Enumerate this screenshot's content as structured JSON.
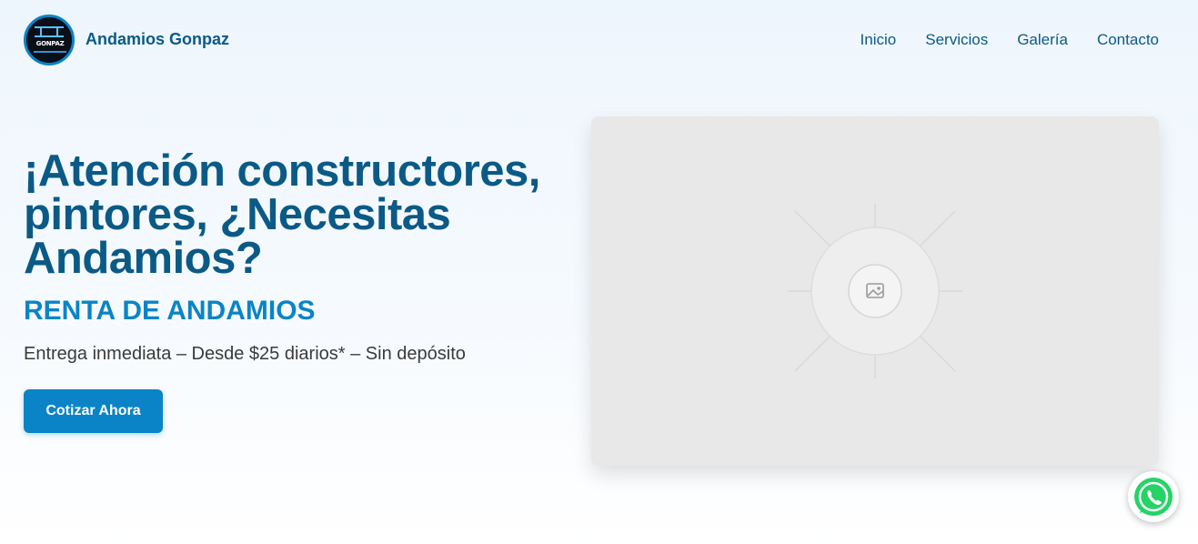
{
  "brand": {
    "name": "Andamios Gonpaz",
    "logo_text": "GONPAZ"
  },
  "nav": {
    "items": [
      "Inicio",
      "Servicios",
      "Galería",
      "Contacto"
    ]
  },
  "hero": {
    "headline": "¡Atención constructores, pintores, ¿Necesitas Andamios?",
    "subheadline": "RENTA DE ANDAMIOS",
    "tagline": "Entrega inmediata – Desde $25 diarios* – Sin depósito",
    "cta_label": "Cotizar Ahora",
    "media_icon": "image-placeholder-icon"
  },
  "floating": {
    "whatsapp_icon": "whatsapp-icon"
  },
  "colors": {
    "primary_dark": "#0b5a86",
    "accent": "#0a84c6",
    "whatsapp": "#25d366"
  }
}
